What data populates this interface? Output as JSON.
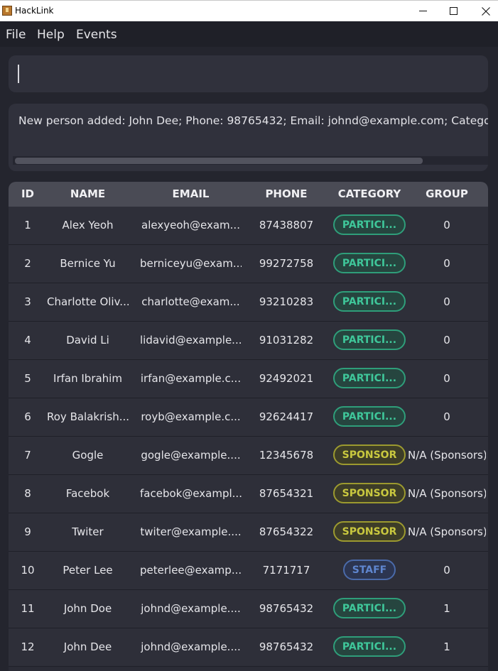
{
  "window": {
    "title": "HackLink",
    "minimize_glyph": "—",
    "maximize_glyph": "☐",
    "close_glyph": "✕"
  },
  "menu": {
    "items": [
      "File",
      "Help",
      "Events"
    ]
  },
  "command": {
    "value": ""
  },
  "result": {
    "text": "New person added: John Dee; Phone: 98765432; Email: johnd@example.com; Category: PA"
  },
  "table": {
    "headers": {
      "id": "ID",
      "name": "NAME",
      "email": "EMAIL",
      "phone": "PHONE",
      "category": "CATEGORY",
      "group": "GROUP"
    },
    "rows": [
      {
        "id": "1",
        "name": "Alex Yeoh",
        "email": "alexyeoh@exam...",
        "phone": "87438807",
        "category": "PARTICI...",
        "type": "participant",
        "group": "0"
      },
      {
        "id": "2",
        "name": "Bernice Yu",
        "email": "berniceyu@exam...",
        "phone": "99272758",
        "category": "PARTICI...",
        "type": "participant",
        "group": "0"
      },
      {
        "id": "3",
        "name": "Charlotte Oliv...",
        "email": "charlotte@exam...",
        "phone": "93210283",
        "category": "PARTICI...",
        "type": "participant",
        "group": "0"
      },
      {
        "id": "4",
        "name": "David Li",
        "email": "lidavid@example...",
        "phone": "91031282",
        "category": "PARTICI...",
        "type": "participant",
        "group": "0"
      },
      {
        "id": "5",
        "name": "Irfan Ibrahim",
        "email": "irfan@example.c...",
        "phone": "92492021",
        "category": "PARTICI...",
        "type": "participant",
        "group": "0"
      },
      {
        "id": "6",
        "name": "Roy Balakrish...",
        "email": "royb@example.c...",
        "phone": "92624417",
        "category": "PARTICI...",
        "type": "participant",
        "group": "0"
      },
      {
        "id": "7",
        "name": "Gogle",
        "email": "gogle@example....",
        "phone": "12345678",
        "category": "SPONSOR",
        "type": "sponsor",
        "group": "N/A (Sponsors)"
      },
      {
        "id": "8",
        "name": "Facebok",
        "email": "facebok@exampl...",
        "phone": "87654321",
        "category": "SPONSOR",
        "type": "sponsor",
        "group": "N/A (Sponsors)"
      },
      {
        "id": "9",
        "name": "Twiter",
        "email": "twiter@example....",
        "phone": "87654322",
        "category": "SPONSOR",
        "type": "sponsor",
        "group": "N/A (Sponsors)"
      },
      {
        "id": "10",
        "name": "Peter Lee",
        "email": "peterlee@examp...",
        "phone": "7171717",
        "category": "STAFF",
        "type": "staff",
        "group": "0"
      },
      {
        "id": "11",
        "name": "John Doe",
        "email": "johnd@example....",
        "phone": "98765432",
        "category": "PARTICI...",
        "type": "participant",
        "group": "1"
      },
      {
        "id": "12",
        "name": "John Dee",
        "email": "johnd@example....",
        "phone": "98765432",
        "category": "PARTICI...",
        "type": "participant",
        "group": "1"
      }
    ]
  },
  "colors": {
    "background": "#24252e",
    "panel": "#30313c",
    "header": "#4a4b55",
    "participant": "#3fc79a",
    "sponsor": "#c9c83f",
    "staff": "#5f86cf"
  }
}
